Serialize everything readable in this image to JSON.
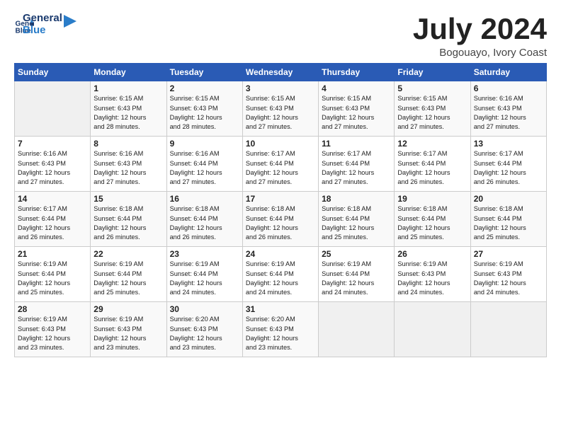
{
  "logo": {
    "line1": "General",
    "line2": "Blue"
  },
  "title": "July 2024",
  "location": "Bogouayo, Ivory Coast",
  "days_header": [
    "Sunday",
    "Monday",
    "Tuesday",
    "Wednesday",
    "Thursday",
    "Friday",
    "Saturday"
  ],
  "weeks": [
    [
      {
        "day": "",
        "info": ""
      },
      {
        "day": "1",
        "info": "Sunrise: 6:15 AM\nSunset: 6:43 PM\nDaylight: 12 hours\nand 28 minutes."
      },
      {
        "day": "2",
        "info": "Sunrise: 6:15 AM\nSunset: 6:43 PM\nDaylight: 12 hours\nand 28 minutes."
      },
      {
        "day": "3",
        "info": "Sunrise: 6:15 AM\nSunset: 6:43 PM\nDaylight: 12 hours\nand 27 minutes."
      },
      {
        "day": "4",
        "info": "Sunrise: 6:15 AM\nSunset: 6:43 PM\nDaylight: 12 hours\nand 27 minutes."
      },
      {
        "day": "5",
        "info": "Sunrise: 6:15 AM\nSunset: 6:43 PM\nDaylight: 12 hours\nand 27 minutes."
      },
      {
        "day": "6",
        "info": "Sunrise: 6:16 AM\nSunset: 6:43 PM\nDaylight: 12 hours\nand 27 minutes."
      }
    ],
    [
      {
        "day": "7",
        "info": "Sunrise: 6:16 AM\nSunset: 6:43 PM\nDaylight: 12 hours\nand 27 minutes."
      },
      {
        "day": "8",
        "info": "Sunrise: 6:16 AM\nSunset: 6:43 PM\nDaylight: 12 hours\nand 27 minutes."
      },
      {
        "day": "9",
        "info": "Sunrise: 6:16 AM\nSunset: 6:44 PM\nDaylight: 12 hours\nand 27 minutes."
      },
      {
        "day": "10",
        "info": "Sunrise: 6:17 AM\nSunset: 6:44 PM\nDaylight: 12 hours\nand 27 minutes."
      },
      {
        "day": "11",
        "info": "Sunrise: 6:17 AM\nSunset: 6:44 PM\nDaylight: 12 hours\nand 27 minutes."
      },
      {
        "day": "12",
        "info": "Sunrise: 6:17 AM\nSunset: 6:44 PM\nDaylight: 12 hours\nand 26 minutes."
      },
      {
        "day": "13",
        "info": "Sunrise: 6:17 AM\nSunset: 6:44 PM\nDaylight: 12 hours\nand 26 minutes."
      }
    ],
    [
      {
        "day": "14",
        "info": "Sunrise: 6:17 AM\nSunset: 6:44 PM\nDaylight: 12 hours\nand 26 minutes."
      },
      {
        "day": "15",
        "info": "Sunrise: 6:18 AM\nSunset: 6:44 PM\nDaylight: 12 hours\nand 26 minutes."
      },
      {
        "day": "16",
        "info": "Sunrise: 6:18 AM\nSunset: 6:44 PM\nDaylight: 12 hours\nand 26 minutes."
      },
      {
        "day": "17",
        "info": "Sunrise: 6:18 AM\nSunset: 6:44 PM\nDaylight: 12 hours\nand 26 minutes."
      },
      {
        "day": "18",
        "info": "Sunrise: 6:18 AM\nSunset: 6:44 PM\nDaylight: 12 hours\nand 25 minutes."
      },
      {
        "day": "19",
        "info": "Sunrise: 6:18 AM\nSunset: 6:44 PM\nDaylight: 12 hours\nand 25 minutes."
      },
      {
        "day": "20",
        "info": "Sunrise: 6:18 AM\nSunset: 6:44 PM\nDaylight: 12 hours\nand 25 minutes."
      }
    ],
    [
      {
        "day": "21",
        "info": "Sunrise: 6:19 AM\nSunset: 6:44 PM\nDaylight: 12 hours\nand 25 minutes."
      },
      {
        "day": "22",
        "info": "Sunrise: 6:19 AM\nSunset: 6:44 PM\nDaylight: 12 hours\nand 25 minutes."
      },
      {
        "day": "23",
        "info": "Sunrise: 6:19 AM\nSunset: 6:44 PM\nDaylight: 12 hours\nand 24 minutes."
      },
      {
        "day": "24",
        "info": "Sunrise: 6:19 AM\nSunset: 6:44 PM\nDaylight: 12 hours\nand 24 minutes."
      },
      {
        "day": "25",
        "info": "Sunrise: 6:19 AM\nSunset: 6:44 PM\nDaylight: 12 hours\nand 24 minutes."
      },
      {
        "day": "26",
        "info": "Sunrise: 6:19 AM\nSunset: 6:43 PM\nDaylight: 12 hours\nand 24 minutes."
      },
      {
        "day": "27",
        "info": "Sunrise: 6:19 AM\nSunset: 6:43 PM\nDaylight: 12 hours\nand 24 minutes."
      }
    ],
    [
      {
        "day": "28",
        "info": "Sunrise: 6:19 AM\nSunset: 6:43 PM\nDaylight: 12 hours\nand 23 minutes."
      },
      {
        "day": "29",
        "info": "Sunrise: 6:19 AM\nSunset: 6:43 PM\nDaylight: 12 hours\nand 23 minutes."
      },
      {
        "day": "30",
        "info": "Sunrise: 6:20 AM\nSunset: 6:43 PM\nDaylight: 12 hours\nand 23 minutes."
      },
      {
        "day": "31",
        "info": "Sunrise: 6:20 AM\nSunset: 6:43 PM\nDaylight: 12 hours\nand 23 minutes."
      },
      {
        "day": "",
        "info": ""
      },
      {
        "day": "",
        "info": ""
      },
      {
        "day": "",
        "info": ""
      }
    ]
  ]
}
